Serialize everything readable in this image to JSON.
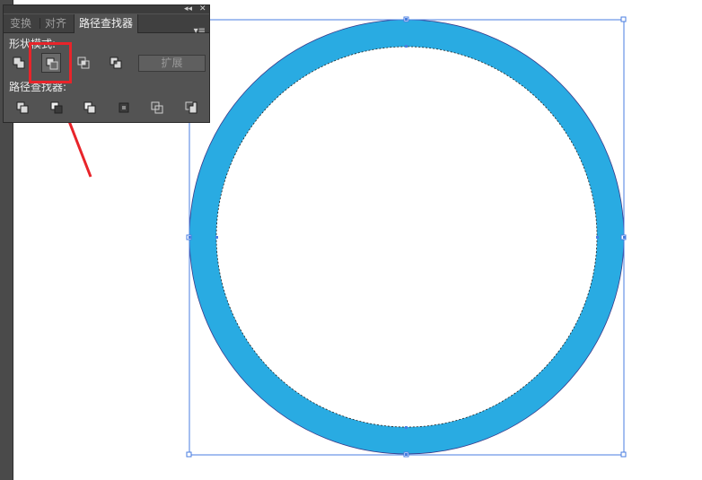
{
  "panel": {
    "collapse_glyph": "◂◂",
    "close_glyph": "✕",
    "menu_glyph": "▾≡",
    "tabs": [
      {
        "label": "变换",
        "active": false
      },
      {
        "label": "对齐",
        "active": false
      },
      {
        "label": "路径查找器",
        "active": true
      }
    ],
    "shape_modes_label": "形状模式:",
    "shape_modes": [
      "unite-icon",
      "minus-front-icon",
      "intersect-icon",
      "exclude-icon"
    ],
    "selected_shape_mode": "minus-front-icon",
    "expand_label": "扩展",
    "pathfinders_label": "路径查找器:",
    "pathfinders": [
      "divide-icon",
      "trim-icon",
      "merge-icon",
      "crop-icon",
      "outline-icon",
      "minus-back-icon"
    ]
  },
  "canvas": {
    "ring_color": "#29abe2",
    "selection_color": "#4a7ee0",
    "annotation_color": "#e8242a"
  }
}
